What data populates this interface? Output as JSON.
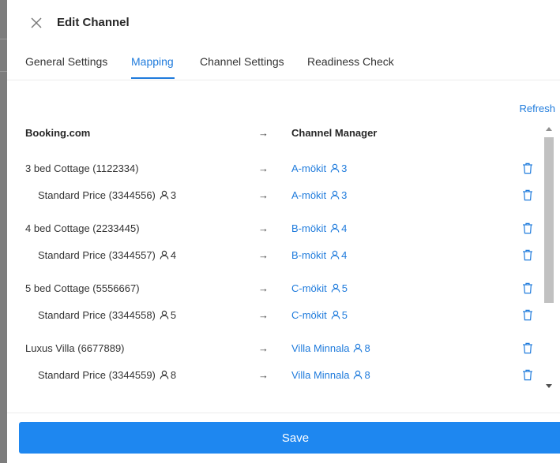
{
  "drawer": {
    "title": "Edit Channel",
    "tabs": [
      {
        "label": "General Settings",
        "active": false
      },
      {
        "label": "Mapping",
        "active": true
      },
      {
        "label": "Channel Settings",
        "active": false
      },
      {
        "label": "Readiness Check",
        "active": false
      }
    ]
  },
  "mapping": {
    "refresh_label": "Refresh",
    "header_left": "Booking.com",
    "header_arrow": "→",
    "header_right": "Channel Manager",
    "rows": [
      {
        "left": "3 bed Cottage (1122334)",
        "left_people": "",
        "right": "A-mökit",
        "right_people": "3"
      },
      {
        "left": "Standard Price (3344556)",
        "left_people": "3",
        "right": "A-mökit",
        "right_people": "3"
      },
      {
        "left": "4 bed Cottage (2233445)",
        "left_people": "",
        "right": "B-mökit",
        "right_people": "4"
      },
      {
        "left": "Standard Price (3344557)",
        "left_people": "4",
        "right": "B-mökit",
        "right_people": "4"
      },
      {
        "left": "5 bed Cottage (5556667)",
        "left_people": "",
        "right": "C-mökit",
        "right_people": "5"
      },
      {
        "left": "Standard Price (3344558)",
        "left_people": "5",
        "right": "C-mökit",
        "right_people": "5"
      },
      {
        "left": "Luxus Villa (6677889)",
        "left_people": "",
        "right": "Villa Minnala",
        "right_people": "8"
      },
      {
        "left": "Standard Price (3344559)",
        "left_people": "8",
        "right": "Villa Minnala",
        "right_people": "8"
      }
    ],
    "row_arrow": "→",
    "icons": {
      "delete": "trash-icon",
      "person": "person-icon",
      "close": "close-icon"
    },
    "accent_color": "#1f7bdc"
  },
  "footer": {
    "save_label": "Save"
  }
}
